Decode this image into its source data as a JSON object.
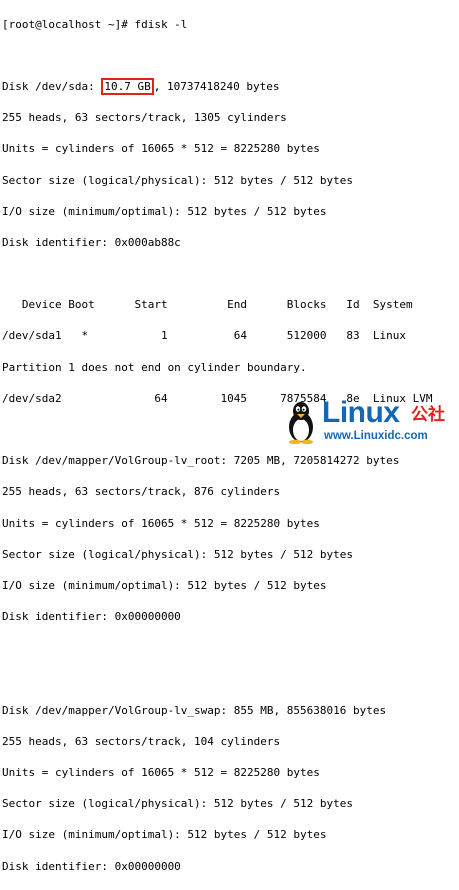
{
  "prompt": "[root@localhost ~]# fdisk -l",
  "sda": {
    "disk_prefix": "Disk /dev/sda: ",
    "disk_size_highlight": "10.7 GB",
    "disk_suffix": ", 10737418240 bytes",
    "geometry": "255 heads, 63 sectors/track, 1305 cylinders",
    "units": "Units = cylinders of 16065 * 512 = 8225280 bytes",
    "sector_size": "Sector size (logical/physical): 512 bytes / 512 bytes",
    "io_size": "I/O size (minimum/optimal): 512 bytes / 512 bytes",
    "identifier": "Disk identifier: 0x000ab88c"
  },
  "partition_table": {
    "header": "   Device Boot      Start         End      Blocks   Id  System",
    "rows": [
      "/dev/sda1   *           1          64      512000   83  Linux",
      "Partition 1 does not end on cylinder boundary.",
      "/dev/sda2              64        1045     7875584   8e  Linux LVM"
    ]
  },
  "lv_root": {
    "disk": "Disk /dev/mapper/VolGroup-lv_root: 7205 MB, 7205814272 bytes",
    "geometry": "255 heads, 63 sectors/track, 876 cylinders",
    "units": "Units = cylinders of 16065 * 512 = 8225280 bytes",
    "sector_size": "Sector size (logical/physical): 512 bytes / 512 bytes",
    "io_size": "I/O size (minimum/optimal): 512 bytes / 512 bytes",
    "identifier": "Disk identifier: 0x00000000"
  },
  "lv_swap": {
    "disk": "Disk /dev/mapper/VolGroup-lv_swap: 855 MB, 855638016 bytes",
    "geometry": "255 heads, 63 sectors/track, 104 cylinders",
    "units": "Units = cylinders of 16065 * 512 = 8225280 bytes",
    "sector_size": "Sector size (logical/physical): 512 bytes / 512 bytes",
    "io_size": "I/O size (minimum/optimal): 512 bytes / 512 bytes",
    "identifier": "Disk identifier: 0x00000000"
  },
  "watermark": {
    "brand": "Linux",
    "cn": "公社",
    "url": "www.Linuxidc.com"
  },
  "colors": {
    "highlight_border": "#e0241b",
    "brand_blue": "#1566b3",
    "brand_red": "#e0241b",
    "text": "#000000",
    "background": "#ffffff"
  }
}
